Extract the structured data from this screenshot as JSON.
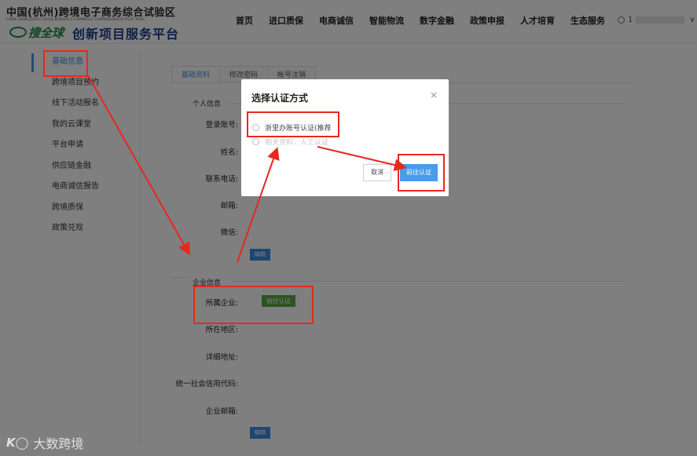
{
  "header": {
    "title": "中国(杭州)跨境电子商务综合试验区",
    "subtitle": "CHINA (HANGZHOU) CROSS-BORDER E-COMMERCE COMPREHENSIVE PILOT AREA",
    "brand": "搜全球",
    "platform": "创新项目服务平台",
    "nav": [
      "首页",
      "进口质保",
      "电商诚信",
      "智能物流",
      "数字金融",
      "政策申报",
      "人才培育",
      "生态服务"
    ],
    "user_prefix": "1",
    "chevron": "∨"
  },
  "sidebar": {
    "items": [
      "基础信息",
      "跨境项目预约",
      "线下活动报名",
      "我的云课堂",
      "平台申请",
      "供应链金融",
      "电商诚信报告",
      "跨境质保",
      "政策兑现"
    ]
  },
  "tabs": [
    "基础资料",
    "修改密码",
    "帐号注销"
  ],
  "personal": {
    "section": "个人信息",
    "labels": [
      "登录账号:",
      "姓名:",
      "联系电话:",
      "邮箱:",
      "微信:"
    ],
    "edit": "编辑"
  },
  "enterprise": {
    "section": "企业信息",
    "labels": [
      "所属企业:",
      "所在地区:",
      "详细地址:",
      "统一社会信用代码:",
      "企业邮箱:"
    ],
    "verify": "前往认证",
    "edit": "编辑"
  },
  "modal": {
    "title": "选择认证方式",
    "close": "×",
    "option1": "浙里办账号认证(推荐",
    "option2": "相关资料，人工认证",
    "cancel": "取消",
    "confirm": "前往认证"
  },
  "watermark": {
    "logo": "K◯",
    "text": "大数跨境"
  },
  "colors": {
    "accent": "#4a9be8",
    "annotation": "#e8281f",
    "verify_green": "#5aa845"
  }
}
